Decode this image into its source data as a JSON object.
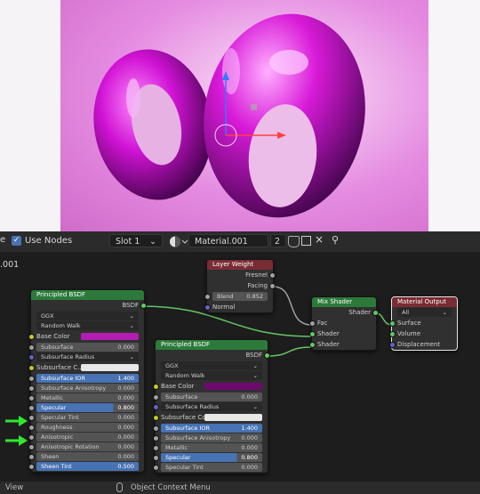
{
  "header": {
    "use_nodes_label": "Use Nodes",
    "slot_label": "Slot 1",
    "material_name": "Material.001",
    "user_count": "2",
    "partial_name": ".001"
  },
  "nodes": {
    "pbsdf1": {
      "title": "Principled BSDF",
      "out_bsdf": "BSDF",
      "distribution": "GGX",
      "sss_method": "Random Walk",
      "base_color": "Base Color",
      "subsurface": "Subsurface",
      "subsurface_value": "0.000",
      "subsurface_radius": "Subsurface Radius",
      "subsurface_color": "Subsurface C...",
      "subsurface_ior": "Subsurface IOR",
      "subsurface_ior_value": "1.400",
      "subsurface_anisotropy": "Subsurface Anisotropy",
      "subsurface_anisotropy_value": "0.000",
      "metallic": "Metallic",
      "metallic_value": "0.000",
      "specular": "Specular",
      "specular_value": "0.800",
      "specular_tint": "Specular Tint",
      "specular_tint_value": "0.000",
      "roughness": "Roughness",
      "roughness_value": "0.000",
      "anisotropic": "Anisotropic",
      "anisotropic_value": "0.000",
      "anisotropic_rotation": "Anisotropic Rotation",
      "anisotropic_rotation_value": "0.000",
      "sheen": "Sheen",
      "sheen_value": "0.000",
      "sheen_tint": "Sheen Tint",
      "sheen_tint_value": "0.500"
    },
    "pbsdf2": {
      "title": "Principled BSDF",
      "out_bsdf": "BSDF",
      "distribution": "GGX",
      "sss_method": "Random Walk",
      "base_color": "Base Color",
      "subsurface": "Subsurface",
      "subsurface_value": "0.000",
      "subsurface_radius": "Subsurface Radius",
      "subsurface_color": "Subsurface Color",
      "subsurface_ior": "Subsurface IOR",
      "subsurface_ior_value": "1.400",
      "subsurface_anisotropy": "Subsurface Anisotropy",
      "subsurface_anisotropy_value": "0.000",
      "metallic": "Metallic",
      "metallic_value": "0.000",
      "specular": "Specular",
      "specular_value": "0.800",
      "specular_tint": "Specular Tint",
      "specular_tint_value": "0.000"
    },
    "layer_weight": {
      "title": "Layer Weight",
      "fresnel": "Fresnel",
      "facing": "Facing",
      "blend": "Blend",
      "blend_value": "0.852",
      "normal": "Normal"
    },
    "mix_shader": {
      "title": "Mix Shader",
      "out_shader": "Shader",
      "fac": "Fac",
      "shader_a": "Shader",
      "shader_b": "Shader"
    },
    "material_output": {
      "title": "Material Output",
      "target": "All",
      "surface": "Surface",
      "volume": "Volume",
      "displacement": "Displacement"
    }
  },
  "status": {
    "left": "View",
    "context_menu": "Object Context Menu"
  },
  "colors": {
    "base_color_1": "#b41db4",
    "base_color_2": "#6e0a6e",
    "subsurface_color": "#e8e8e8",
    "accent": "#4772b3"
  }
}
